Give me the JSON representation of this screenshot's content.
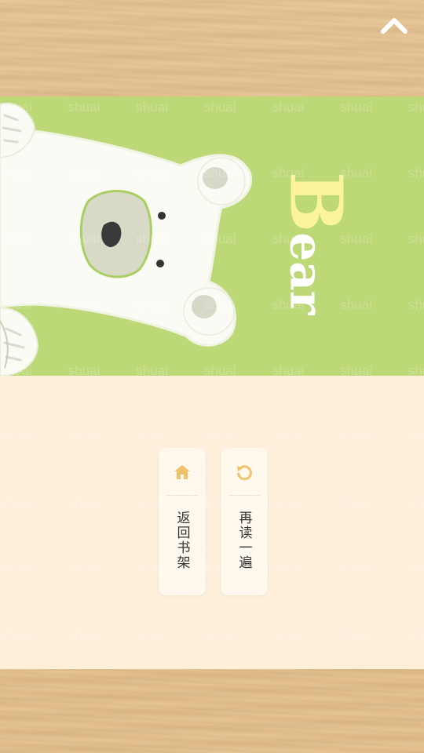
{
  "header": {
    "up_icon": "chevron-up-icon"
  },
  "illustration": {
    "subject": "polar-bear",
    "background_color": "#bdd877",
    "title_first_letter": "B",
    "title_rest": "ear",
    "title_first_letter_color": "#fbf49c",
    "title_rest_color": "#ffffff"
  },
  "watermark": {
    "text": "shuai"
  },
  "actions": {
    "reread": {
      "label": "再读一遍",
      "icon": "refresh-icon",
      "icon_color": "#efc36b"
    },
    "back_to_shelf": {
      "label": "返回书架",
      "icon": "home-icon",
      "icon_color": "#efc36b"
    }
  },
  "colors": {
    "panel_background": "#fdefda",
    "button_background": "#fff8ee"
  }
}
